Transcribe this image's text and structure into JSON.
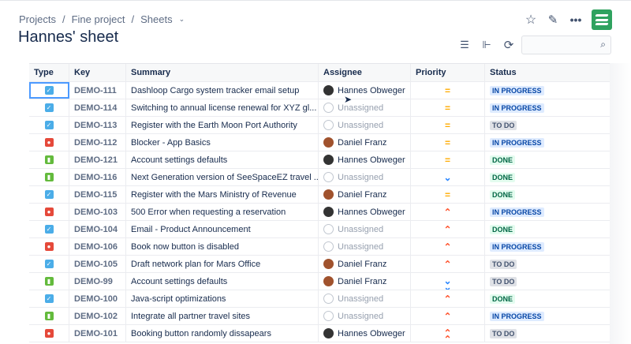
{
  "breadcrumbs": [
    "Projects",
    "Fine project",
    "Sheets"
  ],
  "title": "Hannes' sheet",
  "search": {
    "placeholder": ""
  },
  "columns": [
    "Type",
    "Key",
    "Summary",
    "Assignee",
    "Priority",
    "Status"
  ],
  "colors": {
    "task": "#4bade8",
    "bug": "#e5493a",
    "story": "#63ba3c",
    "medium": "#ffab00",
    "high": "#ff5630",
    "low": "#2684ff",
    "logo": "#2fa25f"
  },
  "rows": [
    {
      "type": "task",
      "key": "DEMO-111",
      "summary": "Dashloop Cargo system tracker email setup",
      "assignee": "Hannes Obweger",
      "priority": "medium",
      "status": "IN PROGRESS"
    },
    {
      "type": "task",
      "key": "DEMO-114",
      "summary": "Switching to annual license renewal for XYZ gl...",
      "assignee": "Unassigned",
      "priority": "medium",
      "status": "IN PROGRESS"
    },
    {
      "type": "task",
      "key": "DEMO-113",
      "summary": "Register with the Earth Moon Port Authority",
      "assignee": "Unassigned",
      "priority": "medium",
      "status": "TO DO"
    },
    {
      "type": "bug",
      "key": "DEMO-112",
      "summary": "Blocker - App Basics",
      "assignee": "Daniel Franz",
      "priority": "medium",
      "status": "IN PROGRESS"
    },
    {
      "type": "story",
      "key": "DEMO-121",
      "summary": "Account settings defaults",
      "assignee": "Hannes Obweger",
      "priority": "medium",
      "status": "DONE"
    },
    {
      "type": "story",
      "key": "DEMO-116",
      "summary": "Next Generation version of SeeSpaceEZ travel ...",
      "assignee": "Unassigned",
      "priority": "low",
      "status": "DONE"
    },
    {
      "type": "task",
      "key": "DEMO-115",
      "summary": "Register with the Mars Ministry of Revenue",
      "assignee": "Daniel Franz",
      "priority": "medium",
      "status": "DONE"
    },
    {
      "type": "bug",
      "key": "DEMO-103",
      "summary": "500 Error when requesting a reservation",
      "assignee": "Hannes Obweger",
      "priority": "high",
      "status": "IN PROGRESS"
    },
    {
      "type": "task",
      "key": "DEMO-104",
      "summary": "Email - Product Announcement",
      "assignee": "Unassigned",
      "priority": "high",
      "status": "DONE"
    },
    {
      "type": "bug",
      "key": "DEMO-106",
      "summary": "Book now button is disabled",
      "assignee": "Unassigned",
      "priority": "high",
      "status": "IN PROGRESS"
    },
    {
      "type": "task",
      "key": "DEMO-105",
      "summary": "Draft network plan for Mars Office",
      "assignee": "Daniel Franz",
      "priority": "high",
      "status": "TO DO"
    },
    {
      "type": "story",
      "key": "DEMO-99",
      "summary": "Account settings defaults",
      "assignee": "Daniel Franz",
      "priority": "lowest",
      "status": "TO DO"
    },
    {
      "type": "task",
      "key": "DEMO-100",
      "summary": "Java-script optimizations",
      "assignee": "Unassigned",
      "priority": "high",
      "status": "DONE"
    },
    {
      "type": "story",
      "key": "DEMO-102",
      "summary": "Integrate all partner travel sites",
      "assignee": "Unassigned",
      "priority": "high",
      "status": "IN PROGRESS"
    },
    {
      "type": "bug",
      "key": "DEMO-101",
      "summary": "Booking button randomly dissapears",
      "assignee": "Hannes Obweger",
      "priority": "highest",
      "status": "TO DO"
    }
  ]
}
